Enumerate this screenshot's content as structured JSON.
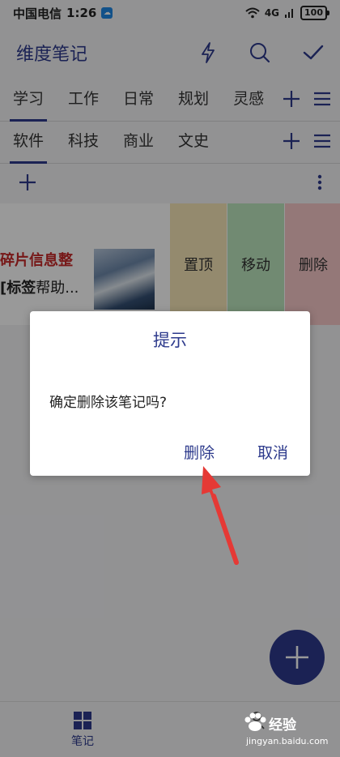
{
  "statusbar": {
    "carrier": "中国电信",
    "time": "1:26",
    "signal_badge": "4G",
    "battery": "100"
  },
  "appbar": {
    "title": "维度笔记",
    "icons": [
      "lightning-icon",
      "search-icon",
      "check-icon"
    ]
  },
  "tabs_primary": {
    "items": [
      "学习",
      "工作",
      "日常",
      "规划",
      "灵感"
    ]
  },
  "tabs_secondary": {
    "items": [
      "软件",
      "科技",
      "商业",
      "文史"
    ]
  },
  "note": {
    "title": "碎片信息整",
    "summary_bold": "标签",
    "summary_rest": "帮助...",
    "summary_prefix": "[",
    "actions": {
      "pin": "置顶",
      "move": "移动",
      "delete": "删除"
    }
  },
  "dialog": {
    "title": "提示",
    "message": "确定删除该笔记吗?",
    "confirm": "删除",
    "cancel": "取消"
  },
  "bottomnav": {
    "notes_label": "笔记"
  },
  "watermark": {
    "brand": "经验",
    "url": "jingyan.baidu.com"
  },
  "colors": {
    "accent": "#2d3a8c",
    "title_red": "#c62828",
    "arrow": "#e53935"
  }
}
